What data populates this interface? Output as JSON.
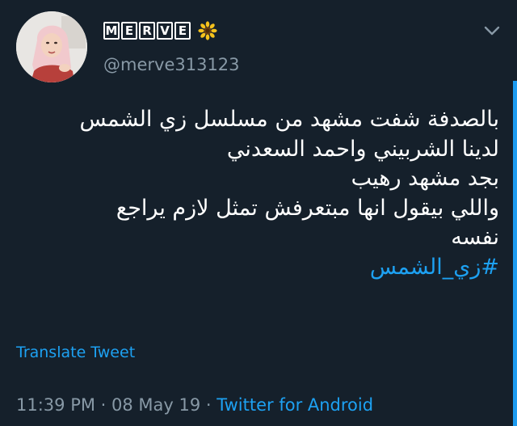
{
  "user": {
    "display_name_letters": [
      "M",
      "E",
      "R",
      "V",
      "E"
    ],
    "handle": "@merve313123",
    "avatar_icon": "profile-photo",
    "name_emoji_icon": "sunflower-icon"
  },
  "tweet": {
    "lines": [
      "بالصدفة شفت مشهد من مسلسل زي الشمس",
      "لدينا الشربيني واحمد السعدني",
      "بجد مشهد رهيب",
      "واللي بيقول انها مبتعرفش تمثل لازم يراجع",
      "نفسه"
    ],
    "hashtag": "#زي_الشمس"
  },
  "actions": {
    "translate_label": "Translate Tweet",
    "more_icon": "chevron-down-icon"
  },
  "meta": {
    "time": "11:39 PM",
    "separator": " · ",
    "date": "08 May 19",
    "source": "Twitter for Android"
  },
  "colors": {
    "background": "#15202b",
    "link": "#1da1f2",
    "secondary_text": "#8899a6",
    "primary_text": "#ffffff"
  }
}
